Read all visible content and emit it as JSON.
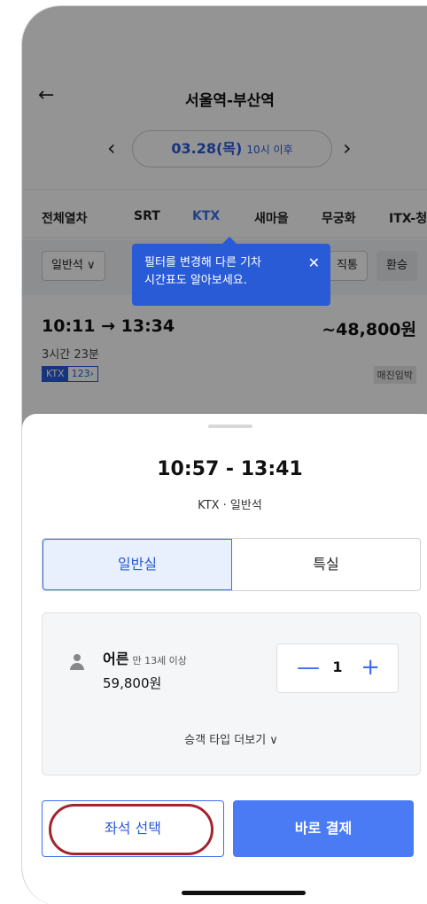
{
  "header": {
    "back_icon": "←",
    "title": "서울역-부산역"
  },
  "date_bar": {
    "prev_icon": "‹",
    "next_icon": "›",
    "date": "03.28(목)",
    "time": "10시 이후"
  },
  "train_type_tabs": [
    {
      "label": "전체열차",
      "active": false
    },
    {
      "label": "SRT",
      "active": false
    },
    {
      "label": "KTX",
      "active": true
    },
    {
      "label": "새마을",
      "active": false
    },
    {
      "label": "무궁화",
      "active": false
    },
    {
      "label": "ITX-청",
      "active": false
    }
  ],
  "filters": {
    "seat_class": "일반석 ∨",
    "direct": "직통",
    "transfer": "환승"
  },
  "tooltip": {
    "text_line1": "필터를 변경해 다른 기차",
    "text_line2": "시간표도 알아보세요.",
    "close_icon": "✕"
  },
  "train_row": {
    "times": "10:11 → 13:34",
    "price": "~48,800원",
    "duration": "3시간 23분",
    "badge_type": "KTX",
    "badge_number": "123›",
    "status": "매진임박"
  },
  "sheet": {
    "times": "10:57 - 13:41",
    "subtitle": "KTX · 일반석",
    "segments": [
      {
        "label": "일반실",
        "active": true
      },
      {
        "label": "특실",
        "active": false
      }
    ],
    "passenger": {
      "label": "어른",
      "note": "만 13세 이상",
      "price": "59,800원",
      "quantity": "1",
      "minus": "—",
      "plus": "+"
    },
    "more_types": "승객 타입 더보기 ∨",
    "seat_select_button": "좌석 선택",
    "pay_button": "바로 결제"
  },
  "colors": {
    "accent": "#3d6ef0",
    "pay": "#4a7bf5",
    "highlight_ring": "#a3242d"
  }
}
